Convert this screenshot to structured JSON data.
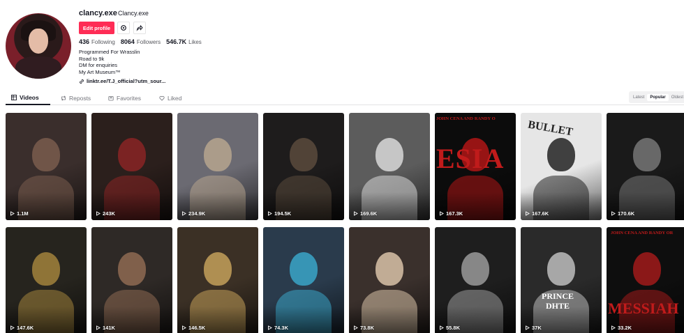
{
  "profile": {
    "username": "clancy.exe",
    "nickname": "Clancy.exe",
    "edit_label": "Edit profile",
    "following_count": "436",
    "following_label": "Following",
    "followers_count": "8064",
    "followers_label": "Followers",
    "likes_count": "546.7K",
    "likes_label": "Likes",
    "bio": [
      "Programmed For Wrasslin",
      "Road to 9k",
      "DM for enquiries",
      "My Art Museum™"
    ],
    "link": "linktr.ee/T.J_official?utm_sour..."
  },
  "tabs": [
    {
      "label": "Videos",
      "icon": "grid-icon"
    },
    {
      "label": "Reposts",
      "icon": "repost-icon"
    },
    {
      "label": "Favorites",
      "icon": "bookmark-icon"
    },
    {
      "label": "Liked",
      "icon": "heart-icon"
    }
  ],
  "sort": {
    "options": [
      "Latest",
      "Popular",
      "Oldest"
    ],
    "selected": "Popular"
  },
  "videos": [
    {
      "views": "1.1M",
      "bg": "#3a2e2c",
      "accent": "#7a5c4e"
    },
    {
      "views": "243K",
      "bg": "#2b1f1c",
      "accent": "#8a2424"
    },
    {
      "views": "234.9K",
      "bg": "#6b6a72",
      "accent": "#b6a48e"
    },
    {
      "views": "194.5K",
      "bg": "#1e1c1c",
      "accent": "#5a4a3c"
    },
    {
      "views": "169.6K",
      "bg": "#5c5c5c",
      "accent": "#d8d8d8"
    },
    {
      "views": "167.3K",
      "bg": "#0c0c0c",
      "accent": "#b01616"
    },
    {
      "views": "167.6K",
      "bg": "#e6e6e6",
      "accent": "#222222"
    },
    {
      "views": "170.6K",
      "bg": "#1a1a1a",
      "accent": "#777777"
    },
    {
      "views": "147.6K",
      "bg": "#26241e",
      "accent": "#a2833c"
    },
    {
      "views": "141K",
      "bg": "#2e2926",
      "accent": "#8e6a52"
    },
    {
      "views": "146.5K",
      "bg": "#3b3025",
      "accent": "#c4a05a"
    },
    {
      "views": "74.3K",
      "bg": "#2a3b4c",
      "accent": "#3aa6c8"
    },
    {
      "views": "73.8K",
      "bg": "#3a302c",
      "accent": "#d9c2a8"
    },
    {
      "views": "55.8K",
      "bg": "#1e1e1e",
      "accent": "#9a9a9a"
    },
    {
      "views": "37K",
      "bg": "#2a2a2a",
      "accent": "#bdbdbd"
    },
    {
      "views": "33.2K",
      "bg": "#0e0e0e",
      "accent": "#a11a1a"
    }
  ],
  "overlay_text": {
    "v6": "JOHN CENA AND RANDY O",
    "v6_big": "ESIA",
    "v7": "BULLET",
    "v15": "PRINCE",
    "v15b": "DHTE",
    "v16": "JOHN CENA AND RANDY OR",
    "v16_big": "MESSIAH"
  }
}
